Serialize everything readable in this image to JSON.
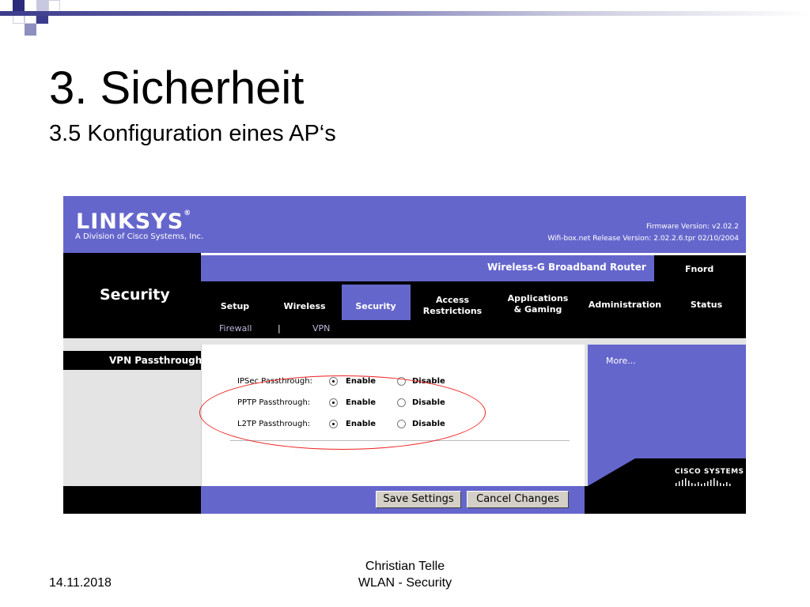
{
  "slide": {
    "title": "3. Sicherheit",
    "subtitle": "3.5  Konfiguration eines AP‘s",
    "footer_date": "14.11.2018",
    "footer_author": "Christian Telle",
    "footer_topic": "WLAN - Security"
  },
  "router": {
    "logo": "LINKSYS",
    "logo_mark": "®",
    "logo_tagline": "A Division of Cisco Systems, Inc.",
    "firmware": "Firmware Version: v2.02.2",
    "release": "Wifi-box.net Release Version: 2.02.2.6.tpr 02/10/2004",
    "section_title": "Security",
    "product_name": "Wireless-G Broadband Router",
    "device_name": "Fnord",
    "tabs": [
      {
        "label": "Setup"
      },
      {
        "label": "Wireless"
      },
      {
        "label": "Security"
      },
      {
        "label": "Access Restrictions"
      },
      {
        "label": "Applications & Gaming"
      },
      {
        "label": "Administration"
      },
      {
        "label": "Status"
      }
    ],
    "subnav": [
      "Firewall",
      "|",
      "VPN"
    ],
    "side_label": "VPN Passthrough",
    "more_link": "More...",
    "rows": [
      {
        "label": "IPSec Passthrough:",
        "enable": "Enable",
        "disable": "Disable",
        "selected": "Enable"
      },
      {
        "label": "PPTP Passthrough:",
        "enable": "Enable",
        "disable": "Disable",
        "selected": "Enable"
      },
      {
        "label": "L2TP Passthrough:",
        "enable": "Enable",
        "disable": "Disable",
        "selected": "Enable"
      }
    ],
    "save_button": "Save Settings",
    "cancel_button": "Cancel Changes",
    "cisco_text": "CISCO SYSTEMS",
    "colors": {
      "brand_blue": "#6566cc",
      "highlight_red": "#e22222"
    }
  }
}
